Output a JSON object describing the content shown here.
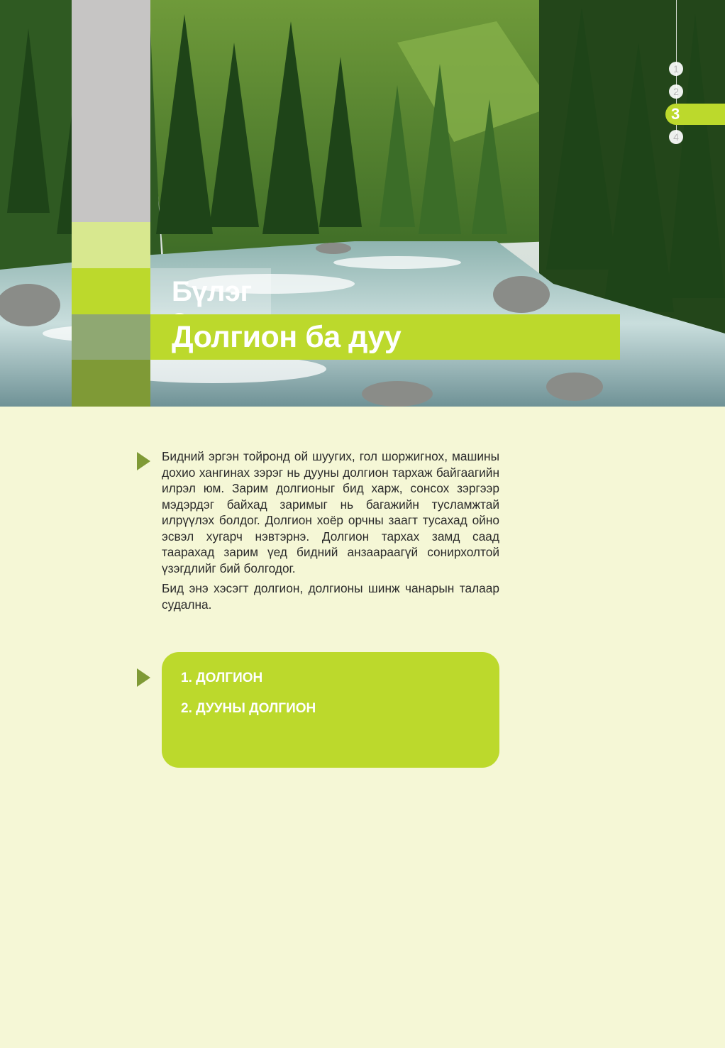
{
  "chapter": {
    "label": "Бүлэг 3",
    "title": "Долгион ба дуу"
  },
  "navigation": {
    "items": [
      "1",
      "2",
      "3",
      "4"
    ],
    "active": "3"
  },
  "intro": {
    "paragraphs": [
      "Бидний эргэн тойронд ой шуугих, гол шоржигнох, машины дохио хангинах зэрэг нь дууны долгион тархаж байгаагийн илрэл юм. Зарим долгионыг бид харж, сонсох зэргээр мэдэрдэг байхад заримыг нь багажийн тусламжтай илрүүлэх болдог. Долгион хоёр орчны заагт тусахад ойно эсвэл хугарч нэвтэрнэ. Долгион тархах замд саад таарахад зарим үед бидний анзаараагүй сонирхолтой үзэгдлийг бий болгодог.",
      "Бид энэ хэсэгт долгион, долгионы шинж чанарын талаар судална."
    ]
  },
  "contents": {
    "items": [
      "1. ДОЛГИОН",
      "2. ДУУНЫ ДОЛГИОН"
    ]
  },
  "colors": {
    "accent": "#bcd92c",
    "dark_green": "#7f9a36",
    "page_bg": "#f5f7d6"
  }
}
